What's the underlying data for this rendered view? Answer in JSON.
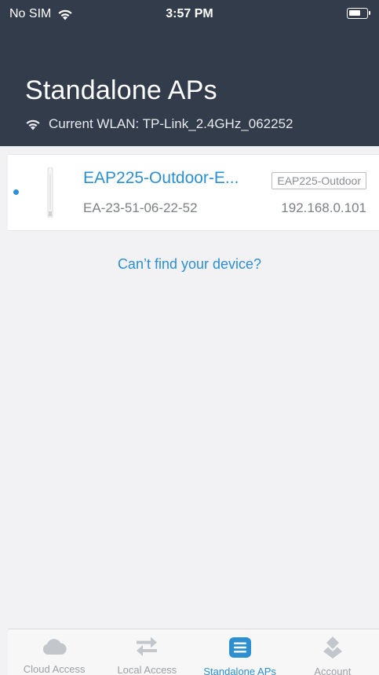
{
  "status_bar": {
    "carrier": "No SIM",
    "time": "3:57 PM"
  },
  "header": {
    "title": "Standalone APs",
    "wlan_text": "Current WLAN: TP-Link_2.4GHz_062252"
  },
  "devices": [
    {
      "name": "EAP225-Outdoor-E...",
      "model": "EAP225-Outdoor",
      "mac": "EA-23-51-06-22-52",
      "ip": "192.168.0.101"
    }
  ],
  "cant_find_link": "Can’t find your device?",
  "tabs": [
    {
      "label": "Cloud Access",
      "icon": "cloud-icon",
      "active": false
    },
    {
      "label": "Local Access",
      "icon": "swap-arrows-icon",
      "active": false
    },
    {
      "label": "Standalone APs",
      "icon": "list-icon",
      "active": true
    },
    {
      "label": "Account",
      "icon": "account-icon",
      "active": false
    }
  ],
  "colors": {
    "header_bg": "#323c4a",
    "accent": "#2c8fcf",
    "inactive_icon": "#c3c6cb",
    "background": "#f2f2f4"
  }
}
